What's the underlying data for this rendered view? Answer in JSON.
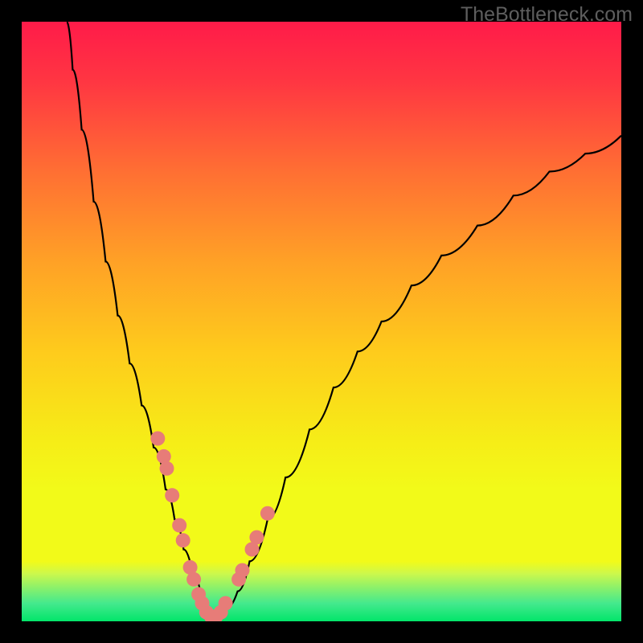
{
  "watermark_text": "TheBottleneck.com",
  "colors": {
    "frame": "#000000",
    "curve": "#000000",
    "marker_fill": "#e77c78",
    "marker_stroke": "#e77c78"
  },
  "chart_data": {
    "type": "line",
    "title": "",
    "xlabel": "",
    "ylabel": "",
    "xlim": [
      0,
      100
    ],
    "ylim": [
      0,
      100
    ],
    "gradient_stops": [
      {
        "offset": 0.0,
        "color": "#ff1b49"
      },
      {
        "offset": 0.1,
        "color": "#ff3642"
      },
      {
        "offset": 0.25,
        "color": "#ff6f33"
      },
      {
        "offset": 0.4,
        "color": "#ffa126"
      },
      {
        "offset": 0.55,
        "color": "#fecb1c"
      },
      {
        "offset": 0.7,
        "color": "#f6ed17"
      },
      {
        "offset": 0.78,
        "color": "#f2fa19"
      },
      {
        "offset": 0.9,
        "color": "#f2fa19"
      },
      {
        "offset": 0.92,
        "color": "#cdf84b"
      },
      {
        "offset": 0.97,
        "color": "#44e98d"
      },
      {
        "offset": 1.0,
        "color": "#02e56a"
      }
    ],
    "series": [
      {
        "name": "bottleneck-curve",
        "x": [
          7.5,
          8.5,
          10,
          12,
          14,
          16,
          18,
          20,
          22,
          24,
          25.5,
          27,
          28.5,
          30,
          31,
          32,
          33,
          34,
          36,
          38,
          41,
          44,
          48,
          52,
          56,
          60,
          65,
          70,
          76,
          82,
          88,
          94,
          100
        ],
        "y": [
          100,
          92,
          82,
          70,
          60,
          51,
          43,
          36,
          29,
          22,
          17,
          12,
          8,
          4,
          2,
          1,
          1,
          2,
          5,
          10,
          17,
          24,
          32,
          39,
          45,
          50,
          56,
          61,
          66,
          71,
          75,
          78,
          81
        ]
      }
    ],
    "markers": {
      "comment": "salmon scatter points overlaid near lower portion of V",
      "x": [
        22.7,
        23.7,
        24.2,
        25.1,
        26.3,
        26.9,
        28.1,
        28.7,
        29.5,
        30.1,
        30.8,
        31.6,
        32.4,
        33.2,
        34.0,
        36.2,
        36.8,
        38.4,
        39.2,
        41.0
      ],
      "y": [
        30.5,
        27.5,
        25.5,
        21.0,
        16.0,
        13.5,
        9.0,
        7.0,
        4.5,
        3.0,
        1.5,
        0.8,
        0.8,
        1.5,
        3.0,
        7.0,
        8.5,
        12.0,
        14.0,
        18.0
      ]
    }
  }
}
